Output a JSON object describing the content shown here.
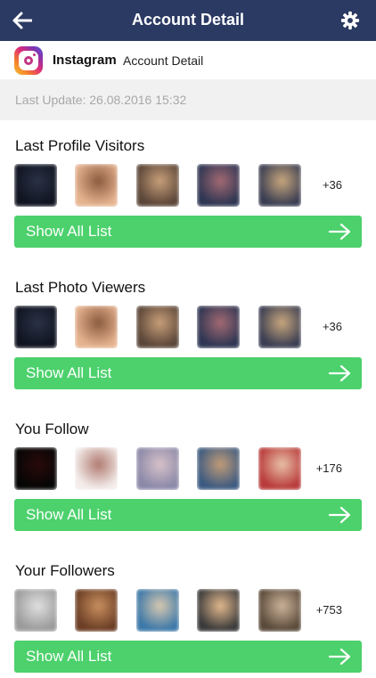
{
  "header": {
    "title": "Account Detail"
  },
  "account": {
    "name": "Instagram",
    "subtitle": "Account Detail"
  },
  "update": {
    "text": "Last Update: 26.08.2016 15:32"
  },
  "sections": [
    {
      "title": "Last Profile Visitors",
      "count": "+36",
      "button": "Show All List",
      "thumbs": [
        [
          "#0f1320",
          "#2b3246"
        ],
        [
          "#e6b38f",
          "#8a5a3f"
        ],
        [
          "#5a4538",
          "#c9a07a"
        ],
        [
          "#2d3552",
          "#a46a73"
        ],
        [
          "#3a3d52",
          "#c9a87d"
        ]
      ]
    },
    {
      "title": "Last Photo Viewers",
      "count": "+36",
      "button": "Show All List",
      "thumbs": [
        [
          "#0f1320",
          "#2b3246"
        ],
        [
          "#e6b38f",
          "#8a5a3f"
        ],
        [
          "#5a4538",
          "#c9a07a"
        ],
        [
          "#2d3552",
          "#a46a73"
        ],
        [
          "#3a3d52",
          "#c9a87d"
        ]
      ]
    },
    {
      "title": "You Follow",
      "count": "+176",
      "button": "Show All List",
      "thumbs": [
        [
          "#050505",
          "#2a0a0a"
        ],
        [
          "#f3ecea",
          "#b07a70"
        ],
        [
          "#8a88a8",
          "#d8c2c9"
        ],
        [
          "#3c5a80",
          "#c29c78"
        ],
        [
          "#b83a3a",
          "#e9c2a8"
        ]
      ]
    },
    {
      "title": "Your Followers",
      "count": "+753",
      "button": "Show All List",
      "thumbs": [
        [
          "#9a9a9a",
          "#e0e0e0"
        ],
        [
          "#6b3e25",
          "#c98f5f"
        ],
        [
          "#3c78a8",
          "#d9c9b0"
        ],
        [
          "#3a3a3a",
          "#e3b98e"
        ],
        [
          "#5a4a3a",
          "#cdb49a"
        ]
      ]
    }
  ]
}
